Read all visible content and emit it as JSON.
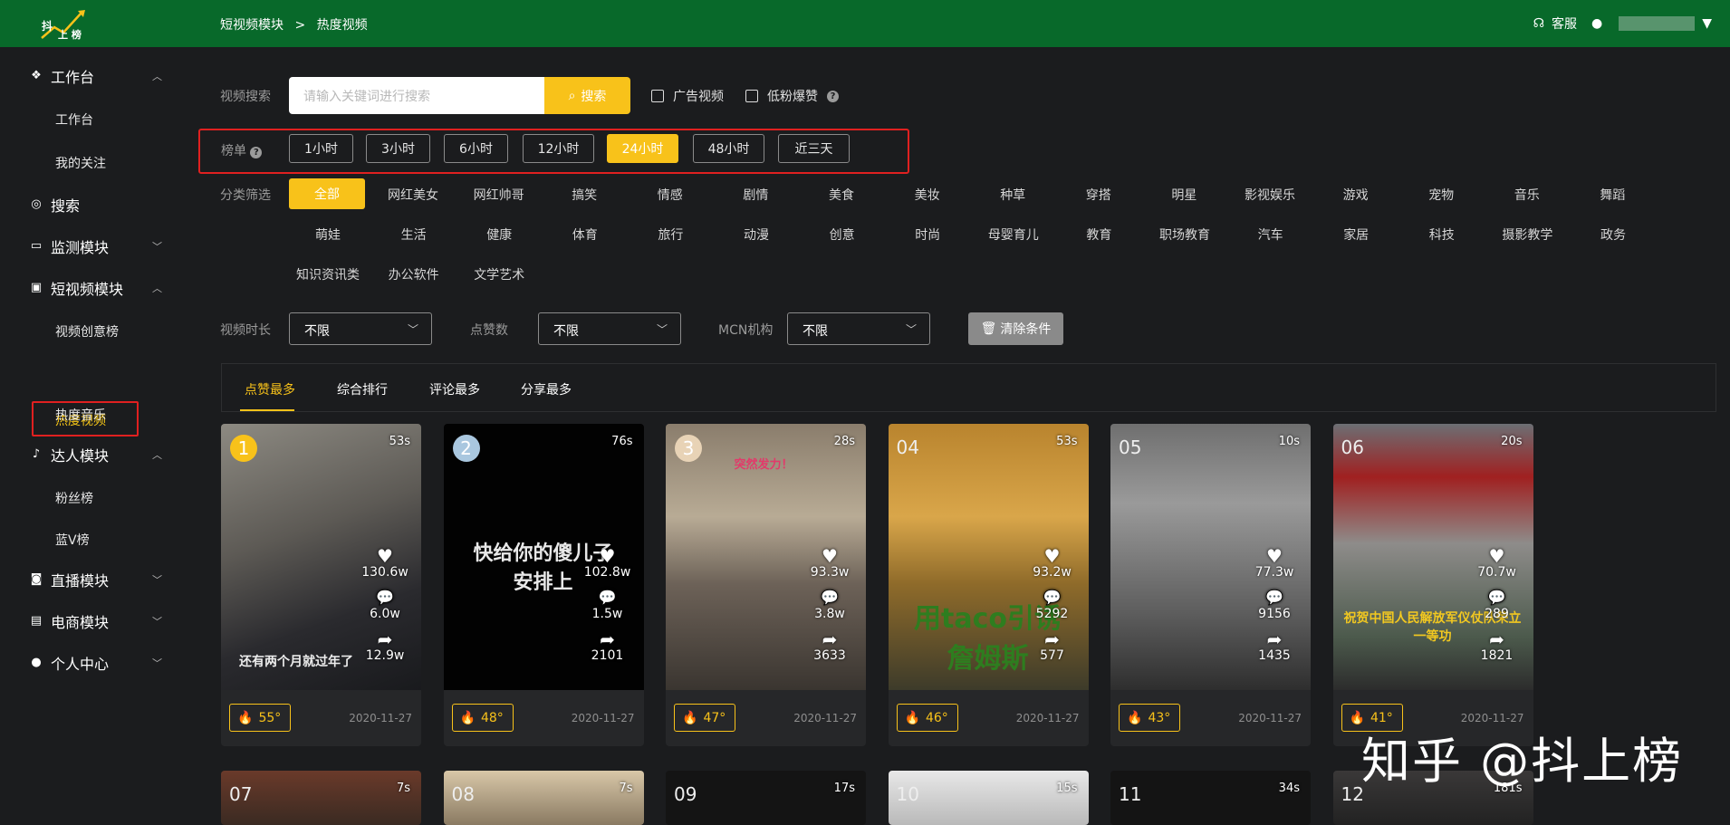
{
  "header": {
    "logo_line1": "抖",
    "logo_line2": "上 榜",
    "breadcrumb": [
      "短视频模块",
      ">",
      "热度视频"
    ],
    "service": "客服"
  },
  "sidebar": {
    "workbench": "工作台",
    "workbench_sub": "工作台",
    "my_follow": "我的关注",
    "search": "搜索",
    "monitor": "监测模块",
    "short_video": "短视频模块",
    "creative_list": "视频创意榜",
    "hot_video": "热度视频",
    "hot_music": "热度音乐",
    "talent": "达人模块",
    "fans_list": "粉丝榜",
    "bluev_list": "蓝V榜",
    "live": "直播模块",
    "ecommerce": "电商模块",
    "personal": "个人中心"
  },
  "filters": {
    "search_label": "视频搜索",
    "search_placeholder": "请输入关键词进行搜索",
    "search_button": "搜索",
    "ad_video": "广告视频",
    "low_fan": "低粉爆赞",
    "rank_label": "榜单",
    "ranges": [
      "1小时",
      "3小时",
      "6小时",
      "12小时",
      "24小时",
      "48小时",
      "近三天"
    ],
    "category_label": "分类筛选",
    "categories_all": "全部",
    "categories_row1": [
      "网红美女",
      "网红帅哥",
      "搞笑",
      "情感",
      "剧情",
      "美食",
      "美妆",
      "种草",
      "穿搭",
      "明星",
      "影视娱乐",
      "游戏",
      "宠物",
      "音乐",
      "舞蹈"
    ],
    "categories_row2": [
      "萌娃",
      "生活",
      "健康",
      "体育",
      "旅行",
      "动漫",
      "创意",
      "时尚",
      "母婴育儿",
      "教育",
      "职场教育",
      "汽车",
      "家居",
      "科技",
      "摄影教学",
      "政务"
    ],
    "categories_row3": [
      "知识资讯类",
      "办公软件",
      "文学艺术"
    ],
    "duration_label": "视频时长",
    "duration_value": "不限",
    "likes_label": "点赞数",
    "likes_value": "不限",
    "mcn_label": "MCN机构",
    "mcn_value": "不限",
    "clear_button": "清除条件"
  },
  "tabs": [
    "点赞最多",
    "综合排行",
    "评论最多",
    "分享最多"
  ],
  "cards": [
    {
      "rank": "1",
      "duration": "53s",
      "likes": "130.6w",
      "comments": "6.0w",
      "shares": "12.9w",
      "heat": "55°",
      "date": "2020-11-27",
      "caption": "还有两个月就过年了"
    },
    {
      "rank": "2",
      "duration": "76s",
      "likes": "102.8w",
      "comments": "1.5w",
      "shares": "2101",
      "heat": "48°",
      "date": "2020-11-27",
      "caption": "快给你的傻儿子安排上"
    },
    {
      "rank": "3",
      "duration": "28s",
      "likes": "93.3w",
      "comments": "3.8w",
      "shares": "3633",
      "heat": "47°",
      "date": "2020-11-27",
      "caption": "突然发力！"
    },
    {
      "rank": "04",
      "duration": "53s",
      "likes": "93.2w",
      "comments": "5292",
      "shares": "577",
      "heat": "46°",
      "date": "2020-11-27",
      "caption": "用taco引诱詹姆斯"
    },
    {
      "rank": "05",
      "duration": "10s",
      "likes": "77.3w",
      "comments": "9156",
      "shares": "1435",
      "heat": "43°",
      "date": "2020-11-27",
      "caption": ""
    },
    {
      "rank": "06",
      "duration": "20s",
      "likes": "70.7w",
      "comments": "289",
      "shares": "1821",
      "heat": "41°",
      "date": "2020-11-27",
      "caption": "祝贺中国人民解放军仪仗队荣立一等功"
    }
  ],
  "cards_row2": [
    {
      "rank": "07",
      "duration": "7s"
    },
    {
      "rank": "08",
      "duration": "7s"
    },
    {
      "rank": "09",
      "duration": "17s"
    },
    {
      "rank": "10",
      "duration": "15s"
    },
    {
      "rank": "11",
      "duration": "34s"
    },
    {
      "rank": "12",
      "duration": "181s"
    }
  ],
  "watermark": "知乎 @抖上榜",
  "colors": {
    "header": "#08692a",
    "accent": "#f8c21a",
    "background": "#1b1c1e",
    "highlight_box": "#e02020"
  }
}
